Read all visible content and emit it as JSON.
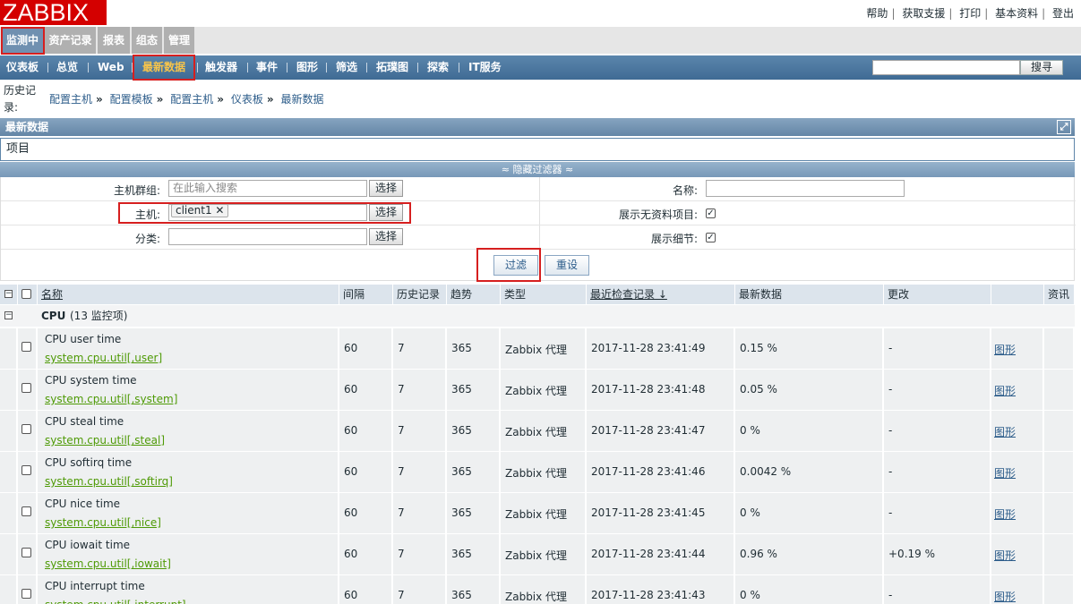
{
  "logo": "ZABBIX",
  "top_links": [
    "帮助",
    "获取支援",
    "打印",
    "基本资料",
    "登出"
  ],
  "main_menu": [
    "监测中",
    "资产记录",
    "报表",
    "组态",
    "管理"
  ],
  "sub_menu": [
    "仪表板",
    "总览",
    "Web",
    "最新数据",
    "触发器",
    "事件",
    "图形",
    "筛选",
    "拓璞图",
    "探索",
    "IT服务"
  ],
  "search_button": "搜寻",
  "history_label": "历史记录:",
  "breadcrumbs": [
    "配置主机",
    "配置模板",
    "配置主机",
    "仪表板",
    "最新数据"
  ],
  "section_title": "最新数据",
  "items_title": "项目",
  "filter_toggle": "≈ 隐藏过滤器 ≈",
  "filter": {
    "hostgroup_label": "主机群组:",
    "hostgroup_placeholder": "在此输入搜索",
    "host_label": "主机:",
    "host_chip": "client1 ✕",
    "app_label": "分类:",
    "select_label": "选择",
    "name_label": "名称:",
    "show_no_data_label": "展示无资料项目:",
    "show_details_label": "展示细节:",
    "filter_button": "过滤",
    "reset_button": "重设"
  },
  "table": {
    "headers": {
      "name": "名称",
      "interval": "间隔",
      "history": "历史记录",
      "trends": "趋势",
      "type": "类型",
      "lastcheck": "最近检查记录 ↓",
      "lastvalue": "最新数据",
      "change": "更改",
      "info": "资讯"
    },
    "group_name": "CPU",
    "group_count": "(13 监控项)",
    "rows": [
      {
        "name": "CPU user time",
        "key": "system.cpu.util[,user]",
        "interval": "60",
        "history": "7",
        "trends": "365",
        "type": "Zabbix 代理",
        "lastcheck": "2017-11-28 23:41:49",
        "lastvalue": "0.15 %",
        "change": "-",
        "graph": "图形"
      },
      {
        "name": "CPU system time",
        "key": "system.cpu.util[,system]",
        "interval": "60",
        "history": "7",
        "trends": "365",
        "type": "Zabbix 代理",
        "lastcheck": "2017-11-28 23:41:48",
        "lastvalue": "0.05 %",
        "change": "-",
        "graph": "图形"
      },
      {
        "name": "CPU steal time",
        "key": "system.cpu.util[,steal]",
        "interval": "60",
        "history": "7",
        "trends": "365",
        "type": "Zabbix 代理",
        "lastcheck": "2017-11-28 23:41:47",
        "lastvalue": "0 %",
        "change": "-",
        "graph": "图形"
      },
      {
        "name": "CPU softirq time",
        "key": "system.cpu.util[,softirq]",
        "interval": "60",
        "history": "7",
        "trends": "365",
        "type": "Zabbix 代理",
        "lastcheck": "2017-11-28 23:41:46",
        "lastvalue": "0.0042 %",
        "change": "-",
        "graph": "图形"
      },
      {
        "name": "CPU nice time",
        "key": "system.cpu.util[,nice]",
        "interval": "60",
        "history": "7",
        "trends": "365",
        "type": "Zabbix 代理",
        "lastcheck": "2017-11-28 23:41:45",
        "lastvalue": "0 %",
        "change": "-",
        "graph": "图形"
      },
      {
        "name": "CPU iowait time",
        "key": "system.cpu.util[,iowait]",
        "interval": "60",
        "history": "7",
        "trends": "365",
        "type": "Zabbix 代理",
        "lastcheck": "2017-11-28 23:41:44",
        "lastvalue": "0.96 %",
        "change": "+0.19 %",
        "graph": "图形"
      },
      {
        "name": "CPU interrupt time",
        "key": "system.cpu.util[,interrupt]",
        "interval": "60",
        "history": "7",
        "trends": "365",
        "type": "Zabbix 代理",
        "lastcheck": "2017-11-28 23:41:43",
        "lastvalue": "0 %",
        "change": "-",
        "graph": "图形"
      }
    ]
  }
}
